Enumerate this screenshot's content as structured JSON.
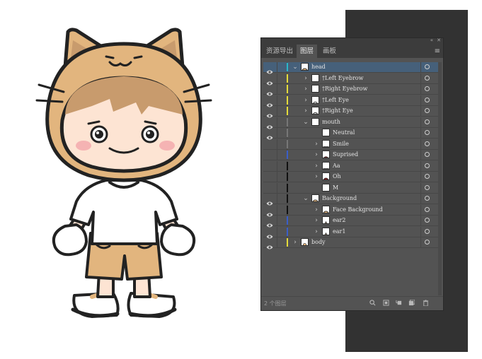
{
  "panel": {
    "tabs": [
      {
        "label": "资源导出",
        "active": false
      },
      {
        "label": "图层",
        "active": true
      },
      {
        "label": "画板",
        "active": false
      }
    ],
    "layer_count": "2 个图层",
    "collapse_glyph": "«",
    "close_glyph": "✕"
  },
  "layers": [
    {
      "name": "head",
      "color": "#2bb7c9",
      "visible": true,
      "arrow": "down",
      "depth": 0,
      "thumb": "head-thumb-icon",
      "selected": true
    },
    {
      "name": "†Left Eyebrow",
      "color": "#e5dc3a",
      "visible": true,
      "arrow": "right",
      "depth": 1,
      "thumb": "eyebrow-thumb-icon"
    },
    {
      "name": "†Right Eyebrow",
      "color": "#e5dc3a",
      "visible": true,
      "arrow": "right",
      "depth": 1,
      "thumb": "eyebrow-thumb-icon"
    },
    {
      "name": "†Left Eye",
      "color": "#e5dc3a",
      "visible": true,
      "arrow": "right",
      "depth": 1,
      "thumb": "eye-thumb-icon"
    },
    {
      "name": "†Right Eye",
      "color": "#e5dc3a",
      "visible": true,
      "arrow": "right",
      "depth": 1,
      "thumb": "eye-thumb-icon"
    },
    {
      "name": "mouth",
      "color": "#777777",
      "visible": true,
      "arrow": "down",
      "depth": 1,
      "thumb": "mouth-thumb-icon"
    },
    {
      "name": "Neutral",
      "color": "#777777",
      "visible": true,
      "arrow": "",
      "depth": 2,
      "thumb": "neutral-thumb-icon"
    },
    {
      "name": "Smile",
      "color": "#777777",
      "visible": false,
      "arrow": "right",
      "depth": 2,
      "thumb": "smile-thumb-icon"
    },
    {
      "name": "Suprised",
      "color": "#3a5ec9",
      "visible": false,
      "arrow": "right",
      "depth": 2,
      "thumb": "surprised-thumb-icon"
    },
    {
      "name": "Aa",
      "color": "#111111",
      "visible": false,
      "arrow": "right",
      "depth": 2,
      "thumb": "aa-thumb-icon"
    },
    {
      "name": "Oh",
      "color": "#111111",
      "visible": false,
      "arrow": "right",
      "depth": 2,
      "thumb": "oh-thumb-icon"
    },
    {
      "name": "M",
      "color": "#111111",
      "visible": false,
      "arrow": "",
      "depth": 2,
      "thumb": "m-thumb-icon"
    },
    {
      "name": "Background",
      "color": "#111111",
      "visible": true,
      "arrow": "down",
      "depth": 1,
      "thumb": "face-thumb-icon"
    },
    {
      "name": "Face Background",
      "color": "#111111",
      "visible": true,
      "arrow": "right",
      "depth": 2,
      "thumb": "face-thumb-icon"
    },
    {
      "name": "ear2",
      "color": "#3a5ec9",
      "visible": true,
      "arrow": "right",
      "depth": 2,
      "thumb": "ear-thumb-icon"
    },
    {
      "name": "ear1",
      "color": "#3a5ec9",
      "visible": true,
      "arrow": "right",
      "depth": 2,
      "thumb": "ear-thumb-icon"
    },
    {
      "name": "body",
      "color": "#e5dc3a",
      "visible": true,
      "arrow": "right",
      "depth": 0,
      "thumb": "body-thumb-icon"
    }
  ],
  "colors": {
    "panel_bg": "#535353",
    "selected_row": "#46607a",
    "artboard": "#323232",
    "skin": "#fde4d3",
    "hood": "#e2b57e",
    "hair": "#c89b6d",
    "outline": "#222222"
  }
}
